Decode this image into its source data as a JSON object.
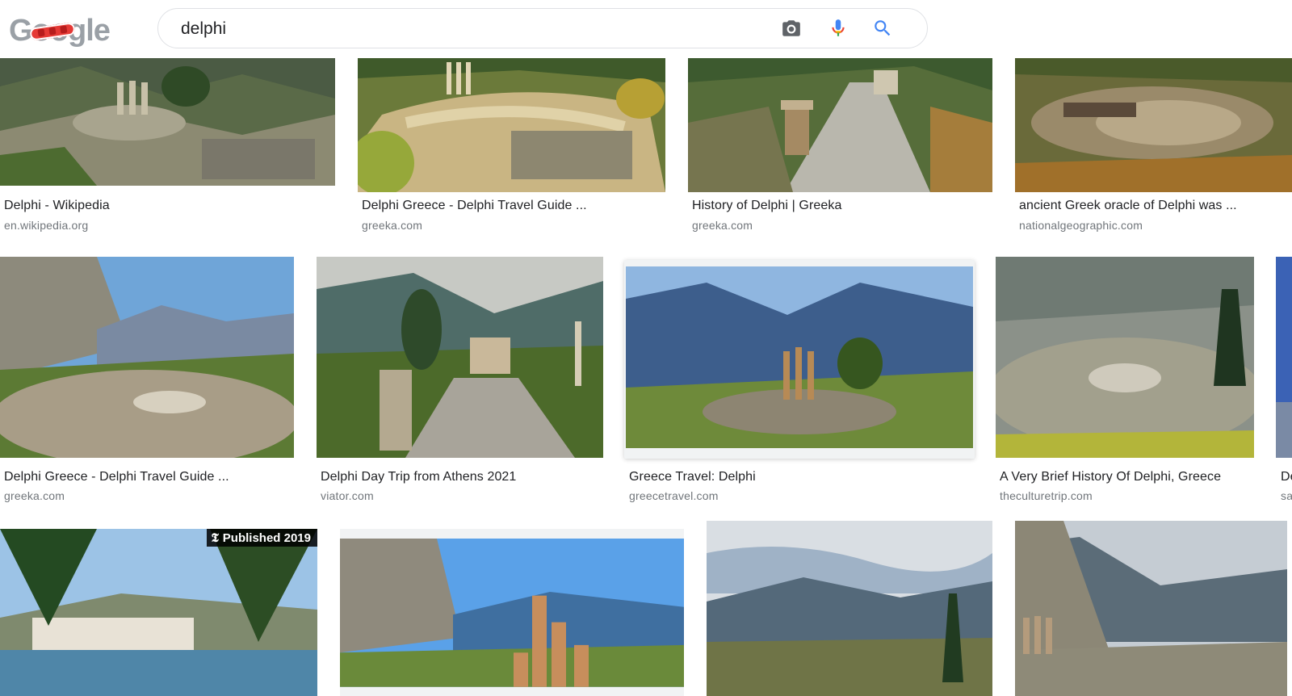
{
  "search": {
    "query": "delphi"
  },
  "header_icons": [
    "camera-icon",
    "microphone-icon",
    "search-icon"
  ],
  "colors": {
    "accent_blue": "#4285f4",
    "mic_red": "#ea4335",
    "source_gray": "#70757a"
  },
  "results": [
    {
      "title": "Delphi - Wikipedia",
      "source": "en.wikipedia.org"
    },
    {
      "title": "Delphi Greece - Delphi Travel Guide ...",
      "source": "greeka.com"
    },
    {
      "title": "History of Delphi | Greeka",
      "source": "greeka.com"
    },
    {
      "title": "ancient Greek oracle of Delphi was ...",
      "source": "nationalgeographic.com"
    },
    {
      "title": "Delphi Greece - Delphi Travel Guide ...",
      "source": "greeka.com"
    },
    {
      "title": "Delphi Day Trip from Athens 2021",
      "source": "viator.com"
    },
    {
      "title": "Greece Travel: Delphi",
      "source": "greecetravel.com",
      "selected": true
    },
    {
      "title": "A Very Brief History Of Delphi, Greece",
      "source": "theculturetrip.com"
    },
    {
      "title": "De",
      "source": "sa"
    },
    {
      "title": "",
      "source": "",
      "badge": "Published 2019"
    },
    {
      "title": "",
      "source": ""
    },
    {
      "title": "",
      "source": ""
    },
    {
      "title": "",
      "source": ""
    }
  ]
}
